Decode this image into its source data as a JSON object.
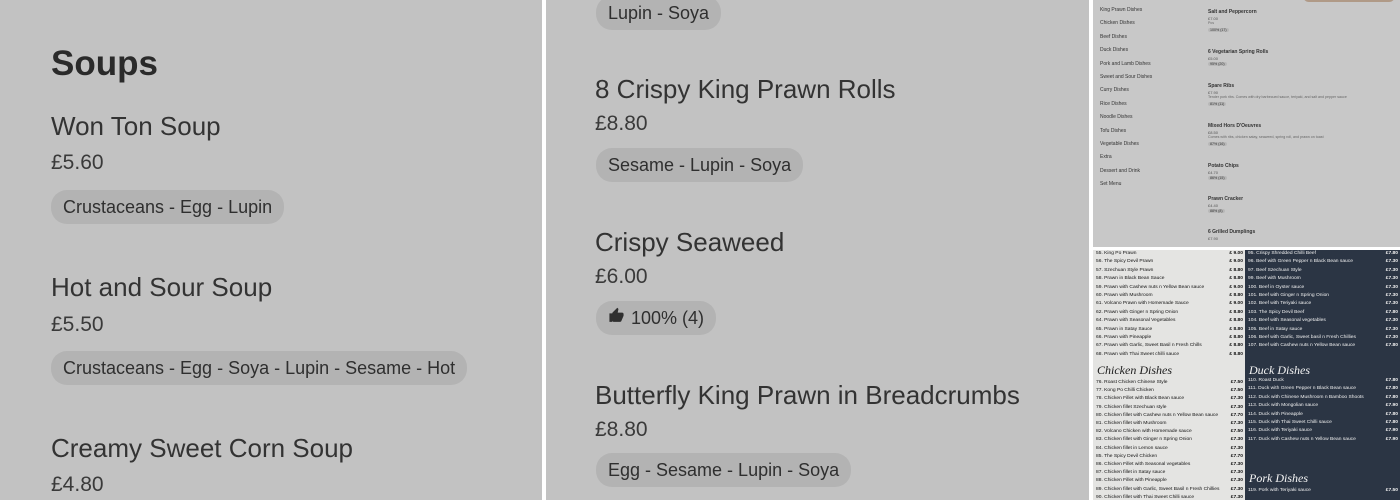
{
  "panel1": {
    "heading": "Soups",
    "items": [
      {
        "name": "Won Ton Soup",
        "price": "£5.60",
        "allergens": "Crustaceans - Egg - Lupin"
      },
      {
        "name": "Hot and Sour Soup",
        "price": "£5.50",
        "allergens": "Crustaceans - Egg - Soya - Lupin - Sesame - Hot"
      },
      {
        "name": "Creamy Sweet Corn Soup",
        "price": "£4.80"
      }
    ]
  },
  "panel2": {
    "top_tag": "Lupin - Soya",
    "items": [
      {
        "name": "8 Crispy King Prawn Rolls",
        "price": "£8.80",
        "tag": "Sesame - Lupin - Soya"
      },
      {
        "name": "Crispy Seaweed",
        "price": "£6.00",
        "tag": "100% (4)"
      },
      {
        "name": "Butterfly King Prawn in Breadcrumbs",
        "price": "£8.80",
        "tag": "Egg - Sesame - Lupin - Soya"
      }
    ],
    "thumb_icon": "thumbs-up-icon"
  },
  "panel3": {
    "categories": [
      "King Prawn Dishes",
      "Chicken Dishes",
      "Beef Dishes",
      "Duck Dishes",
      "Pork and Lamb Dishes",
      "Sweet and Sour Dishes",
      "Curry Dishes",
      "Rice Dishes",
      "Noodle Dishes",
      "Tofu Dishes",
      "Vegetable Dishes",
      "Extra",
      "Dessert and Drink",
      "Set Menu"
    ],
    "items": [
      {
        "name": "Salt and Peppercorn",
        "price": "£7.00",
        "sub": "Pcs",
        "tag": "100% (17)"
      },
      {
        "name": "6 Vegetarian Spring Rolls",
        "price": "£5.00",
        "tag": "95% (20)"
      },
      {
        "name": "Spare Ribs",
        "price": "£7.90",
        "desc": "Tender pork ribs. Comes with dry barbecued sauce, teriyaki, and salt and pepper sauce",
        "tag": "81% (11)"
      },
      {
        "name": "Mixed Hors D'Oeuvres",
        "price": "£8.50",
        "desc": "Comes with ribs, chicken satay, seaweed, spring roll, and prawn on toast",
        "tag": "87% (16)"
      },
      {
        "name": "Potato Chips",
        "price": "£4.70",
        "tag": "86% (15)"
      },
      {
        "name": "Prawn Cracker",
        "price": "£4.40",
        "tag": "88% (8)"
      },
      {
        "name": "6 Grilled Dumplings",
        "price": "£7.90"
      }
    ]
  },
  "panel4": {
    "left_rows_top": [
      {
        "t": "55. King Po Prawn",
        "p": "£ 9.00"
      },
      {
        "t": "56. The Spicy Devil Prawn",
        "p": "£ 9.00"
      },
      {
        "t": "57. Szechuan Style Prawn",
        "p": "£ 8.80"
      },
      {
        "t": "58. Prawn in Black Bean Sauce",
        "p": "£ 8.80"
      },
      {
        "t": "59. Prawn with Cashew nuts n Yellow Bean sauce",
        "p": "£ 9.00"
      },
      {
        "t": "60. Prawn with Mushroom",
        "p": "£ 8.80"
      },
      {
        "t": "61. Volcano Prawn with Homemade Sauce",
        "p": "£ 9.00"
      },
      {
        "t": "62. Prawn with Ginger n Spring Onion",
        "p": "£ 8.80"
      },
      {
        "t": "64. Prawn with Seasonal Vegetables",
        "p": "£ 8.80"
      },
      {
        "t": "65. Prawn in Satay Sauce",
        "p": "£ 8.80"
      },
      {
        "t": "66. Prawn with Pineapple",
        "p": "£ 8.80"
      },
      {
        "t": "67. Prawn with Garlic, Sweet Basil n Fresh Chills",
        "p": "£ 8.80"
      },
      {
        "t": "68. Prawn with Thai Sweet chilli sauce",
        "p": "£ 8.80"
      }
    ],
    "left_section": "Chicken Dishes",
    "left_rows_bottom": [
      {
        "t": "76. Roast Chicken Chinese Style",
        "p": "£7.50"
      },
      {
        "t": "77. Kong Po Chilli Chicken",
        "p": "£7.50"
      },
      {
        "t": "78. Chicken Fillet with Black Bean sauce",
        "p": "£7.30"
      },
      {
        "t": "79. Chicken fillet Szechuan style",
        "p": "£7.30"
      },
      {
        "t": "80. Chicken fillet with Cashew nuts n Yellow Bean sauce",
        "p": "£7.70"
      },
      {
        "t": "81. Chicken fillet with Mushroom",
        "p": "£7.30"
      },
      {
        "t": "82. Volcano Chicken with Homemade sauce",
        "p": "£7.50"
      },
      {
        "t": "83. Chicken fillet with Ginger n Spring Onion",
        "p": "£7.30"
      },
      {
        "t": "84. Chicken fillet in Lemon sauce",
        "p": "£7.30"
      },
      {
        "t": "85. The Spicy Devil Chicken",
        "p": "£7.70"
      },
      {
        "t": "86. Chicken Fillet with Seasonal vegetables",
        "p": "£7.30"
      },
      {
        "t": "87. Chicken fillet in Satay sauce",
        "p": "£7.30"
      },
      {
        "t": "88. Chicken Fillet with Pineapple",
        "p": "£7.30"
      },
      {
        "t": "89. Chicken fillet with Garlic, Sweet Basil n Fresh Chillies",
        "p": "£7.30"
      },
      {
        "t": "90. Chicken fillet with Thai Sweet Chilli sauce",
        "p": "£7.30"
      }
    ],
    "right_rows_top": [
      {
        "t": "95. Crispy Shredded Chilli Beef",
        "p": "£7.80"
      },
      {
        "t": "96. Beef with Green Pepper n Black Bean sauce",
        "p": "£7.30"
      },
      {
        "t": "97. Beef Szechuan Style",
        "p": "£7.30"
      },
      {
        "t": "99. Beef with Mushroom",
        "p": "£7.30"
      },
      {
        "t": "100. Beef in Oyster sauce",
        "p": "£7.30"
      },
      {
        "t": "101. Beef with Ginger n Spring Onion",
        "p": "£7.30"
      },
      {
        "t": "102. Beef with Teriyaki sauce",
        "p": "£7.30"
      },
      {
        "t": "103. The Spicy Devil Beef",
        "p": "£7.80"
      },
      {
        "t": "104. Beef with Seasonal vegetables",
        "p": "£7.30"
      },
      {
        "t": "105. Beef in Satay sauce",
        "p": "£7.30"
      },
      {
        "t": "106. Beef with Garlic, Sweet basil n Fresh Chillies",
        "p": "£7.30"
      },
      {
        "t": "107. Beef with Cashew nuts n Yellow Bean sauce",
        "p": "£7.80"
      }
    ],
    "right_section": "Duck Dishes",
    "right_rows_bottom": [
      {
        "t": "110. Roast Duck",
        "p": "£7.80"
      },
      {
        "t": "111. Duck with Green Pepper n Black Bean sauce",
        "p": "£7.80"
      },
      {
        "t": "112. Duck with Chinese Mushroom n Bamboo Shoots",
        "p": "£7.80"
      },
      {
        "t": "113. Duck with Mongolian sauce",
        "p": "£7.90"
      },
      {
        "t": "114. Duck with Pineapple",
        "p": "£7.80"
      },
      {
        "t": "115. Duck with Thai Sweet Chilli sauce",
        "p": "£7.80"
      },
      {
        "t": "116. Duck with Teriyaki sauce",
        "p": "£7.90"
      },
      {
        "t": "117. Duck with Cashew nuts n Yellow Bean sauce",
        "p": "£7.90"
      }
    ],
    "right_section2": "Pork Dishes",
    "right_rows_last": [
      {
        "t": "119. Pork with Teriyaki sauce",
        "p": "£7.50"
      }
    ]
  }
}
